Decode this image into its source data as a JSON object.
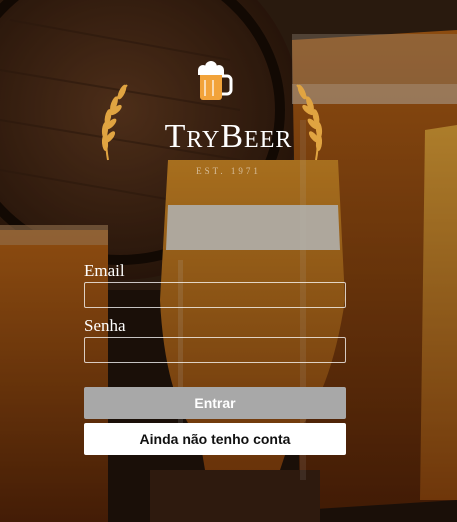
{
  "brand": {
    "name": "TryBeer",
    "established": "EST. 1971"
  },
  "form": {
    "email_label": "Email",
    "email_value": "",
    "password_label": "Senha",
    "password_value": "",
    "login_button": "Entrar",
    "register_button": "Ainda não tenho conta"
  },
  "icons": {
    "logo": "beer-mug-icon",
    "laurel": "wheat-laurel-icon"
  },
  "colors": {
    "login_button_bg": "#a8a8a8",
    "register_button_bg": "#ffffff",
    "laurel": "#e0a441",
    "mug": "#f2a33a"
  }
}
